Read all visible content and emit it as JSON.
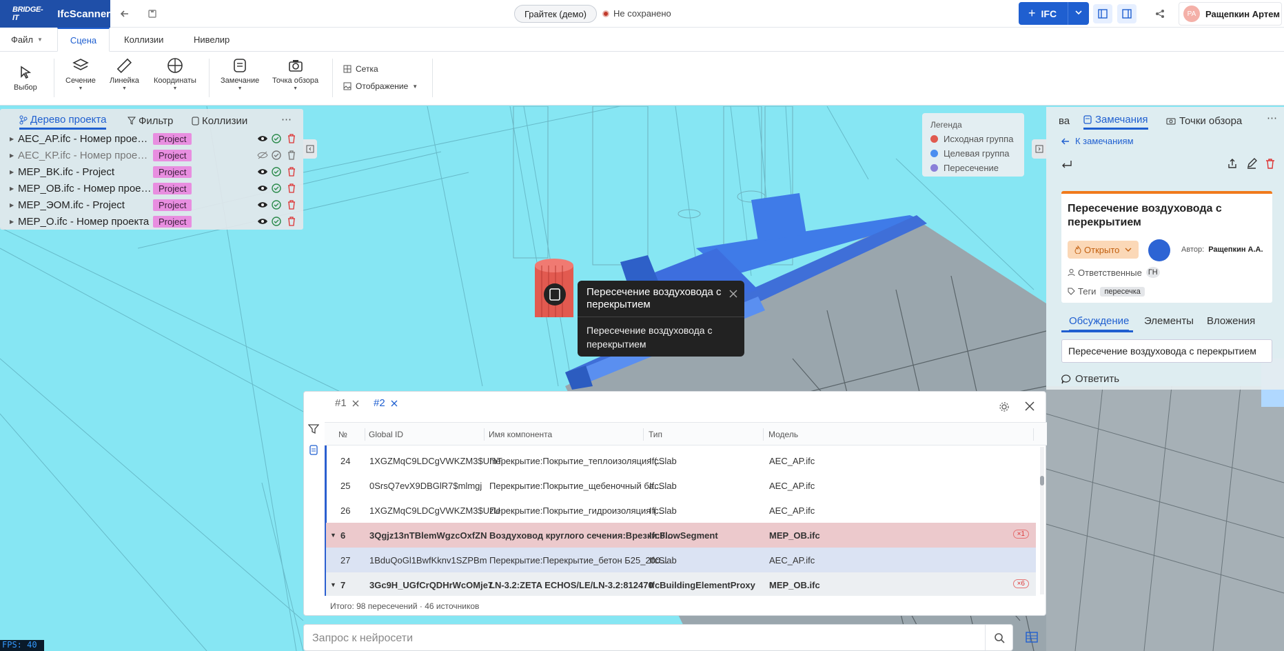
{
  "app": {
    "logo_text": "BRIDGE-IT",
    "name": "IfcScanner"
  },
  "header": {
    "project": "Грайтек (демо)",
    "save_status": "Не сохранено",
    "ifc_button": "IFC",
    "user_initials": "РА",
    "user_name": "Ращепкин Артем"
  },
  "menu": {
    "file": "Файл",
    "tabs": [
      "Сцена",
      "Коллизии",
      "Нивелир"
    ]
  },
  "toolbar": {
    "select": "Выбор",
    "section": "Сечение",
    "ruler": "Линейка",
    "coords": "Координаты",
    "remark": "Замечание",
    "viewpoint": "Точка обзора",
    "grid": "Сетка",
    "display": "Отображение"
  },
  "left_panel": {
    "tabs": [
      "Дерево проекта",
      "Фильтр",
      "Коллизии"
    ],
    "items": [
      {
        "name": "AEC_AP.ifc - Номер проекта",
        "tag": "Project"
      },
      {
        "name": "AEC_KP.ifc - Номер проекта",
        "tag": "Project"
      },
      {
        "name": "MEP_BK.ifc - Project",
        "tag": "Project"
      },
      {
        "name": "MEP_OB.ifc - Номер проекта",
        "tag": "Project"
      },
      {
        "name": "MEP_ЭОМ.ifc - Project",
        "tag": "Project"
      },
      {
        "name": "MEP_O.ifc - Номер проекта",
        "tag": "Project"
      }
    ]
  },
  "legend": {
    "title": "Легенда",
    "items": [
      {
        "label": "Исходная группа",
        "color": "#e05a4f"
      },
      {
        "label": "Целевая группа",
        "color": "#4b8ef0"
      },
      {
        "label": "Пересечение",
        "color": "#8a7fd8"
      }
    ]
  },
  "popup": {
    "title": "Пересечение воздуховода с перекрытием",
    "body": "Пересечение воздуховода с перекрытием"
  },
  "right_panel": {
    "tabs": [
      "ва",
      "Замечания",
      "Точки обзора"
    ],
    "back": "К замечаниям",
    "card": {
      "title": "Пересечение воздуховода с перекрытием",
      "status": "Открыто",
      "author_label": "Автор:",
      "author": "Ращепкин А.А.",
      "responsible_label": "Ответственные",
      "responsible_chip": "ГН",
      "tags_label": "Теги",
      "tag": "пересечка"
    },
    "subtabs": [
      "Обсуждение",
      "Элементы",
      "Вложения"
    ],
    "comment": "Пересечение воздуховода с перекрытием",
    "reply": "Ответить"
  },
  "table": {
    "tabs": [
      "#1",
      "#2"
    ],
    "columns": [
      "№",
      "Global ID",
      "Имя компонента",
      "Тип",
      "Модель"
    ],
    "rows": [
      {
        "n": "24",
        "gid": "1XGZMqC9LDCgVWKZM3$UmT",
        "name": "Перекрытие:Покрытие_теплоизоляция (...",
        "type": "IfcSlab",
        "model": "AEC_AP.ifc",
        "badge": ""
      },
      {
        "n": "25",
        "gid": "0SrsQ7evX9DBGlR7$mlmgj",
        "name": "Перекрытие:Покрытие_щебеночный ба...",
        "type": "IfcSlab",
        "model": "AEC_AP.ifc",
        "badge": ""
      },
      {
        "n": "26",
        "gid": "1XGZMqC9LDCgVWKZM3$UzU",
        "name": "Перекрытие:Покрытие_гидроизоляция (...",
        "type": "IfcSlab",
        "model": "AEC_AP.ifc",
        "badge": ""
      },
      {
        "n": "6",
        "gid": "3Qgjz13nTBlemWgzcOxfZN",
        "name": "Воздуховод круглого сечения:Врезки:8...",
        "type": "IfcFlowSegment",
        "model": "MEP_OB.ifc",
        "badge": "×1"
      },
      {
        "n": "27",
        "gid": "1BduQoGl1BwfKknv1SZPBm",
        "name": "Перекрытие:Перекрытие_бетон Б25_200...",
        "type": "IfcSlab",
        "model": "AEC_AP.ifc",
        "badge": ""
      },
      {
        "n": "7",
        "gid": "3Gc9H_UGfCrQDHrWcOMje7",
        "name": "LN-3.2:ZETA ECHOS/LE/LN-3.2:812470",
        "type": "IfcBuildingElementProxy",
        "model": "MEP_OB.ifc",
        "badge": "×6"
      }
    ],
    "footer": "Итого: 98 пересечений · 46 источников"
  },
  "ai_input": {
    "placeholder": "Запрос к нейросети"
  },
  "fps": "FPS: 40"
}
